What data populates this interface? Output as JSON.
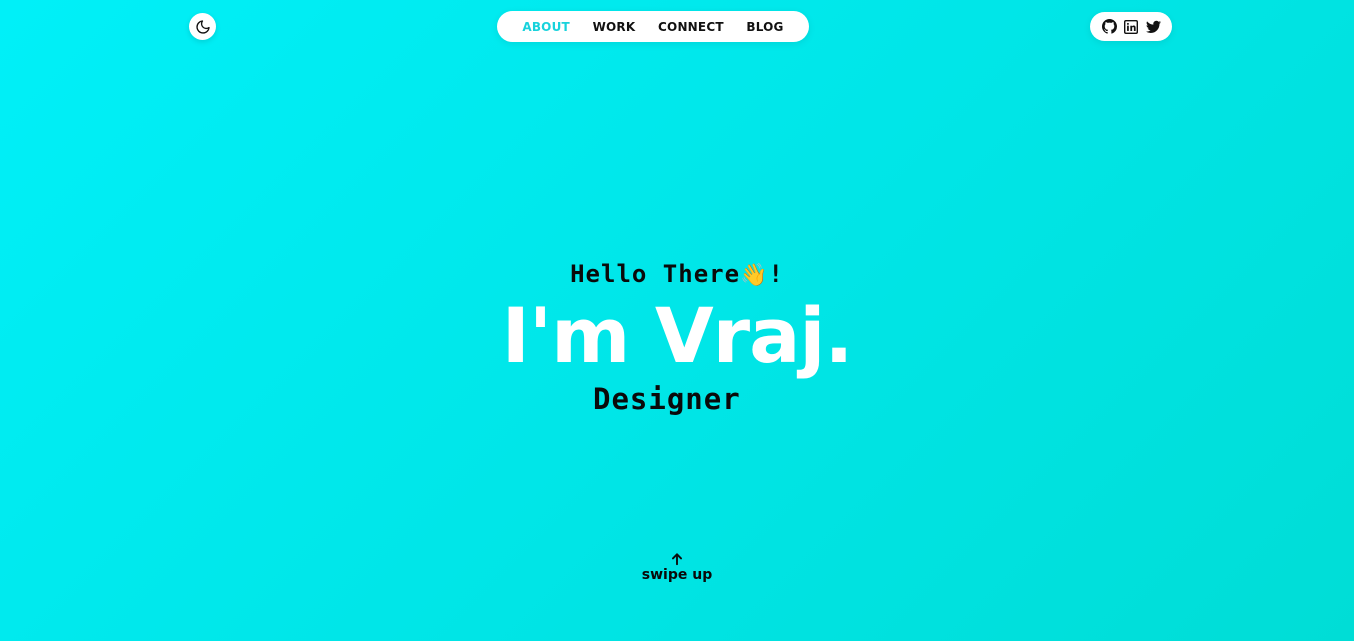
{
  "header": {
    "theme_toggle_icon": "moon-icon",
    "nav": [
      {
        "label": "ABOUT",
        "active": true
      },
      {
        "label": "WORK",
        "active": false
      },
      {
        "label": "CONNECT",
        "active": false
      },
      {
        "label": "BLOG",
        "active": false
      }
    ],
    "socials": [
      {
        "icon": "github-icon"
      },
      {
        "icon": "linkedin-icon"
      },
      {
        "icon": "twitter-icon"
      }
    ]
  },
  "hero": {
    "greeting_text": "Hello There",
    "greeting_emoji": "👋",
    "greeting_end": "!",
    "name": "I'm Vraj.",
    "role": "Designer"
  },
  "footer": {
    "swipe_label": "swipe up",
    "swipe_icon": "arrow-up-icon"
  },
  "colors": {
    "background_start": "#00f0f8",
    "background_end": "#00ddd6",
    "accent": "#18d2dc",
    "text_dark": "#0a0a0a",
    "text_light": "#ffffff"
  }
}
